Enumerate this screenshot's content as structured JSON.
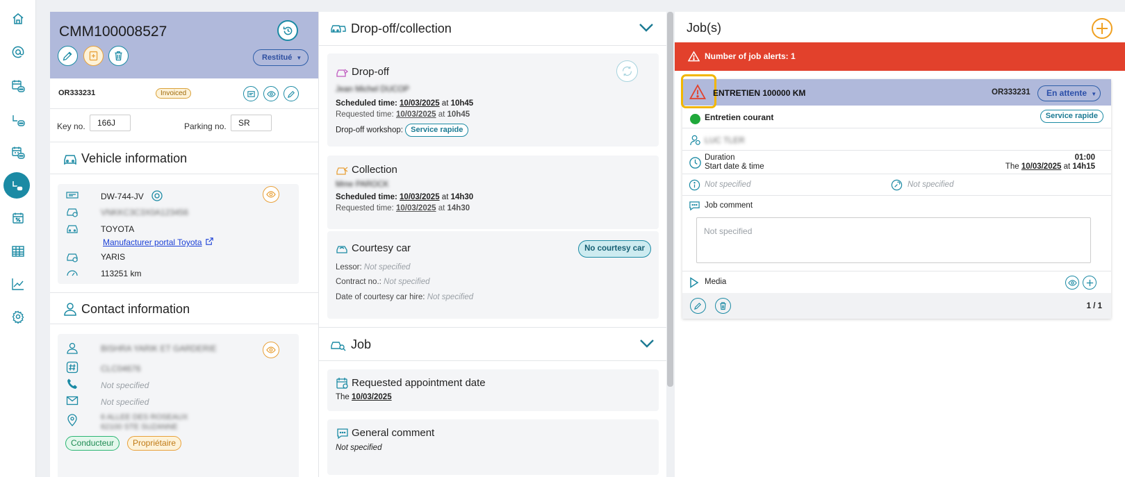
{
  "left": {
    "title": "CMM100008527",
    "status_select": "Restitué",
    "or_id": "OR333231",
    "invoice_badge": "Invoiced",
    "key_label": "Key no.",
    "key_value": "166J",
    "parking_label": "Parking no.",
    "parking_value": "SR",
    "vehicle_section": "Vehicle information",
    "vehicle": {
      "plate": "DW-744-JV",
      "vin": "VNKKC3C3X0A123456",
      "brand": "TOYOTA",
      "portal_link": "Manufacturer portal Toyota",
      "model": "YARIS",
      "mileage": "113251 km"
    },
    "contact_section": "Contact information",
    "contact": {
      "name": "BISHRA YARIK ET GARDERIE",
      "client_id": "CLC04676",
      "phone": "Not specified",
      "email": "Not specified",
      "address_line1": "6 ALLEE DES ROSEAUX",
      "address_line2": "62100 STE SUZANNE",
      "tags": [
        "Conducteur",
        "Propriétaire"
      ]
    }
  },
  "middle": {
    "dropoff_section": "Drop-off/collection",
    "dropoff": {
      "title": "Drop-off",
      "person": "Jean Michel DUCOP",
      "scheduled_label": "Scheduled time:",
      "scheduled_date": "10/03/2025",
      "at1": "at",
      "scheduled_hour": "10h45",
      "requested_label": "Requested time:",
      "requested_date": "10/03/2025",
      "at2": "at",
      "requested_hour": "10h45",
      "workshop_label": "Drop-off workshop:",
      "workshop": "Service rapide"
    },
    "collection": {
      "title": "Collection",
      "person": "Mme PAROCK",
      "scheduled_label": "Scheduled time:",
      "scheduled_date": "10/03/2025",
      "at1": "at",
      "scheduled_hour": "14h30",
      "requested_label": "Requested time:",
      "requested_date": "10/03/2025",
      "at2": "at",
      "requested_hour": "14h30"
    },
    "courtesy": {
      "title": "Courtesy car",
      "badge": "No courtesy car",
      "lessor_label": "Lessor:",
      "lessor": "Not specified",
      "contract_label": "Contract no.:",
      "contract": "Not specified",
      "hire_label": "Date of courtesy car hire:",
      "hire": "Not specified"
    },
    "job_section": "Job",
    "appointment": {
      "title": "Requested appointment date",
      "prefix": "The",
      "date": "10/03/2025"
    },
    "comment": {
      "title": "General comment",
      "value": "Not specified"
    }
  },
  "right": {
    "title": "Job(s)",
    "alert": "Number of job alerts: 1",
    "job": {
      "title": "ENTRETIEN 100000 KM",
      "or_id": "OR333231",
      "status": "En attente",
      "type": "Entretien courant",
      "type_badge": "Service rapide",
      "technician": "LUC TLER",
      "duration_label": "Duration",
      "duration": "01:00",
      "start_label": "Start date & time",
      "start_prefix": "The",
      "start_date": "10/03/2025",
      "start_at": "at",
      "start_hour": "14h15",
      "info1": "Not specified",
      "info2": "Not specified",
      "comment_label": "Job comment",
      "comment_placeholder": "Not specified",
      "media_label": "Media",
      "pagination": "1 / 1"
    }
  },
  "colors": {
    "accent": "#1b8aa4",
    "header_bg": "#b0b9db",
    "alert": "#e2412c",
    "orange": "#e8a13a"
  }
}
